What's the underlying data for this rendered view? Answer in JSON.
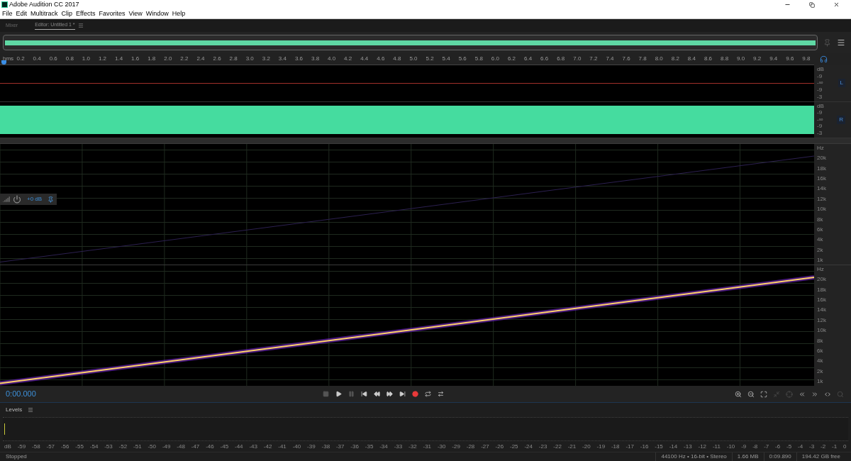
{
  "window": {
    "title": "Adobe Audition CC 2017"
  },
  "menu": [
    "File",
    "Edit",
    "Multitrack",
    "Clip",
    "Effects",
    "Favorites",
    "View",
    "Window",
    "Help"
  ],
  "panel_tabs": [
    {
      "label": "Mixer",
      "selected": false
    },
    {
      "label": "Editor: Untitled 1 *",
      "selected": true
    }
  ],
  "ruler": {
    "unit": "hms",
    "ticks": [
      "0.2",
      "0.4",
      "0.6",
      "0.8",
      "1.0",
      "1.2",
      "1.4",
      "1.6",
      "1.8",
      "2.0",
      "2.2",
      "2.4",
      "2.6",
      "2.8",
      "3.0",
      "3.2",
      "3.4",
      "3.6",
      "3.8",
      "4.0",
      "4.2",
      "4.4",
      "4.6",
      "4.8",
      "5.0",
      "5.2",
      "5.4",
      "5.6",
      "5.8",
      "6.0",
      "6.2",
      "6.4",
      "6.6",
      "6.8",
      "7.0",
      "7.2",
      "7.4",
      "7.6",
      "7.8",
      "8.0",
      "8.2",
      "8.4",
      "8.6",
      "8.8",
      "9.0",
      "9.2",
      "9.4",
      "9.6",
      "9.8"
    ]
  },
  "waveform_channels": [
    {
      "label": "L",
      "kind": "silent",
      "db_labels": [
        "dB",
        "-9",
        "-∞",
        "-9",
        "-3"
      ]
    },
    {
      "label": "R",
      "kind": "full",
      "db_labels": [
        "dB",
        "-9",
        "-∞",
        "-9",
        "-3"
      ]
    }
  ],
  "spectral_channels": [
    {
      "kind": "faint",
      "freq_labels": [
        "Hz",
        "20k",
        "18k",
        "16k",
        "14k",
        "12k",
        "10k",
        "8k",
        "6k",
        "4k",
        "2k",
        "1k"
      ]
    },
    {
      "kind": "bright",
      "freq_labels": [
        "Hz",
        "20k",
        "18k",
        "16k",
        "14k",
        "12k",
        "10k",
        "8k",
        "6k",
        "4k",
        "2k",
        "1k"
      ]
    }
  ],
  "hud": {
    "gain": "+0 dB"
  },
  "current_time": "0:00.000",
  "transport": [
    {
      "kind": "stop",
      "disabled": true
    },
    {
      "kind": "play",
      "disabled": false
    },
    {
      "kind": "pause",
      "disabled": true
    },
    {
      "kind": "start",
      "disabled": false
    },
    {
      "kind": "rewind",
      "disabled": false
    },
    {
      "kind": "forward",
      "disabled": false
    },
    {
      "kind": "end",
      "disabled": false
    },
    {
      "kind": "record",
      "disabled": false
    },
    {
      "kind": "loop",
      "disabled": false
    },
    {
      "kind": "skip",
      "disabled": false
    }
  ],
  "zoom_tools": [
    {
      "kind": "in",
      "disabled": false
    },
    {
      "kind": "out",
      "disabled": false
    },
    {
      "kind": "fit",
      "disabled": false
    },
    {
      "kind": "full",
      "disabled": true
    },
    {
      "kind": "point",
      "disabled": true
    },
    {
      "kind": "left",
      "disabled": false
    },
    {
      "kind": "right",
      "disabled": false
    },
    {
      "kind": "both",
      "disabled": false
    },
    {
      "kind": "reset",
      "disabled": true
    }
  ],
  "levels": {
    "title": "Levels",
    "scale": [
      "dB",
      "-59",
      "-58",
      "-57",
      "-56",
      "-55",
      "-54",
      "-53",
      "-52",
      "-51",
      "-50",
      "-49",
      "-48",
      "-47",
      "-46",
      "-45",
      "-44",
      "-43",
      "-42",
      "-41",
      "-40",
      "-39",
      "-38",
      "-37",
      "-36",
      "-35",
      "-34",
      "-33",
      "-32",
      "-31",
      "-30",
      "-29",
      "-28",
      "-27",
      "-26",
      "-25",
      "-24",
      "-23",
      "-22",
      "-21",
      "-20",
      "-19",
      "-18",
      "-17",
      "-16",
      "-15",
      "-14",
      "-13",
      "-12",
      "-11",
      "-10",
      "-9",
      "-8",
      "-7",
      "-6",
      "-5",
      "-4",
      "-3",
      "-2",
      "-1",
      "0"
    ]
  },
  "status_bar": {
    "state": "Stopped",
    "fields": [
      "44100 Hz • 16-bit • Stereo",
      "1.66 MB",
      "0:09.890",
      "194.42 GB free"
    ]
  }
}
